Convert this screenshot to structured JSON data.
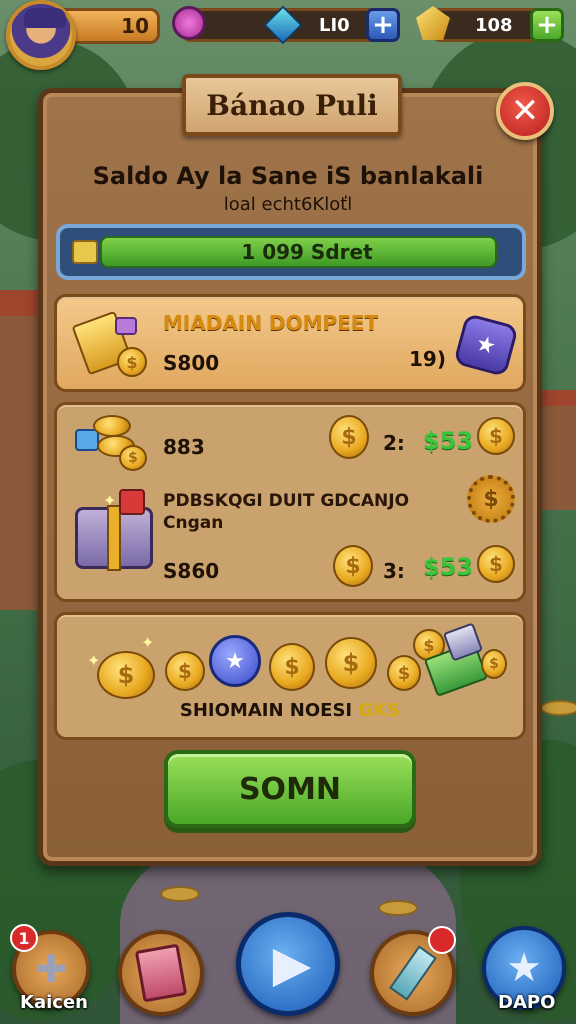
{
  "top_bar": {
    "level_value": "10",
    "gem_count": "LI0",
    "gold_count": "108"
  },
  "panel": {
    "title": "Bánao Puli",
    "heading": "Saldo Ay la Sane iS banlakali",
    "subheading": "loal echt6Kloťl",
    "progress_label": "1 099 Sdret",
    "progress_fraction": 0.96
  },
  "offers": [
    {
      "title": "MIADAIN DOMPEET",
      "price": "S800",
      "right_value": "19)"
    },
    {
      "price": "883",
      "qty": "2:",
      "cash": "$53"
    },
    {
      "title_line1": "PDBSKQGI DUIT GDCANJO",
      "title_line2": "Cngan",
      "price": "S860",
      "qty": "3:",
      "cash": "$53"
    }
  ],
  "rewards": {
    "label_main": "SHIOMAIN NOESI",
    "label_highlight": "GKS"
  },
  "action_button": "SOMN",
  "bottom_nav": [
    {
      "label": "Kaicen",
      "badge": "1"
    },
    {
      "label": ""
    },
    {
      "label": ""
    },
    {
      "label": ""
    },
    {
      "label": "DAPO"
    }
  ],
  "colors": {
    "panel_wood": "#a0744a",
    "accent_green": "#4aa828",
    "close_red": "#d82a2a",
    "cash_green": "#3ac43a"
  }
}
